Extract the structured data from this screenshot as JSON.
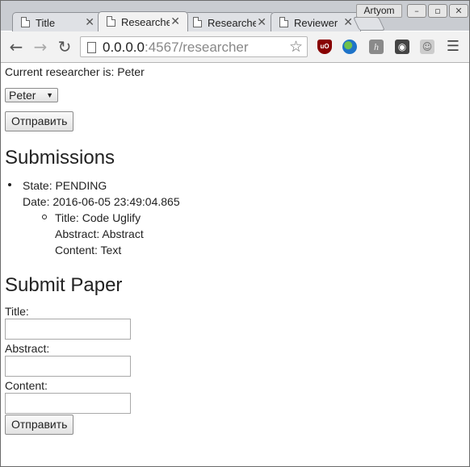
{
  "browser": {
    "tabs": [
      {
        "label": "Title"
      },
      {
        "label": "Researcher"
      },
      {
        "label": "Researcher"
      },
      {
        "label": "Reviewer"
      }
    ],
    "profile_name": "Artyom",
    "url_host": "0.0.0.0",
    "url_path": ":4567/researcher",
    "icons": [
      "back-arrow-icon",
      "forward-arrow-icon",
      "reload-icon",
      "page-icon",
      "bookmark-star-icon",
      "ublock-icon",
      "globe-icon",
      "hypothesis-icon",
      "lightbulb-icon",
      "ghost-icon",
      "menu-icon"
    ]
  },
  "page": {
    "current_researcher": "Current researcher is: Peter",
    "researcher_select": {
      "selected": "Peter"
    },
    "submit_button": "Отправить",
    "submissions_heading": "Submissions",
    "submissions": [
      {
        "state": "State: PENDING",
        "date": "Date: 2016-06-05 23:49:04.865",
        "title": "Title: Code Uglify",
        "abstract": "Abstract: Abstract",
        "content": "Content: Text"
      }
    ],
    "submit_paper_heading": "Submit Paper",
    "form": {
      "title_label": "Title:",
      "abstract_label": "Abstract:",
      "content_label": "Content:",
      "submit_button": "Отправить"
    }
  }
}
